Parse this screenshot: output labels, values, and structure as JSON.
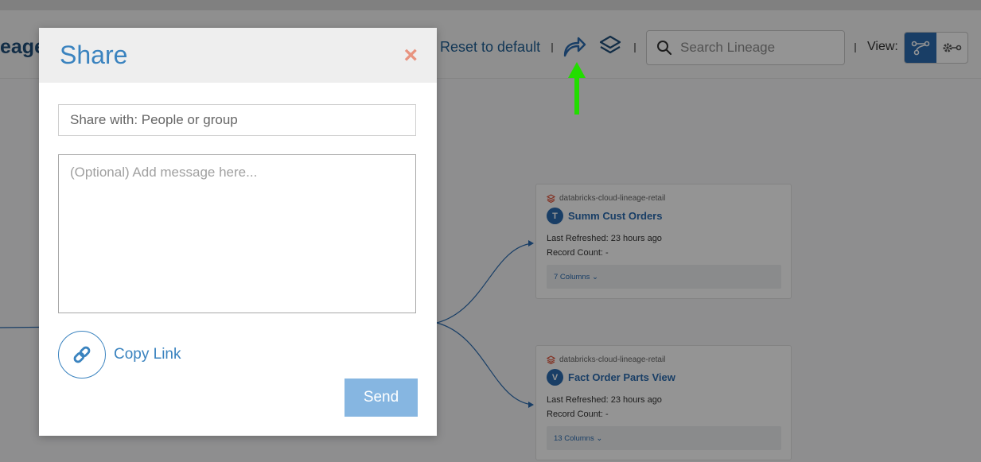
{
  "app": {
    "page_title": "eage",
    "reset_label": "Reset to default",
    "search": {
      "placeholder": "Search Lineage"
    },
    "view_label": "View:",
    "nodes": [
      {
        "source": "databricks-cloud-lineage-retail",
        "badge": "T",
        "name": "Summ Cust Orders",
        "last_refreshed": "Last Refreshed: 23 hours ago",
        "record_count": "Record Count: -",
        "columns": "7 Columns ⌄"
      },
      {
        "source": "databricks-cloud-lineage-retail",
        "badge": "V",
        "name": "Fact Order Parts View",
        "last_refreshed": "Last Refreshed: 23 hours ago",
        "record_count": "Record Count: -",
        "columns": "13 Columns ⌄"
      }
    ]
  },
  "modal": {
    "title": "Share",
    "close_symbol": "×",
    "share_with_placeholder": "Share with: People or group",
    "message_placeholder": "(Optional) Add message here...",
    "copy_link_label": "Copy Link",
    "send_label": "Send"
  },
  "colors": {
    "accent": "#3a83bf",
    "send_button": "#86b6e1",
    "close": "#e8937f",
    "annotation_arrow": "#22dd00"
  },
  "icons": [
    "share-icon",
    "layers-icon",
    "search-icon",
    "lineage-view-icon",
    "settings-view-icon",
    "link-icon",
    "database-icon"
  ]
}
